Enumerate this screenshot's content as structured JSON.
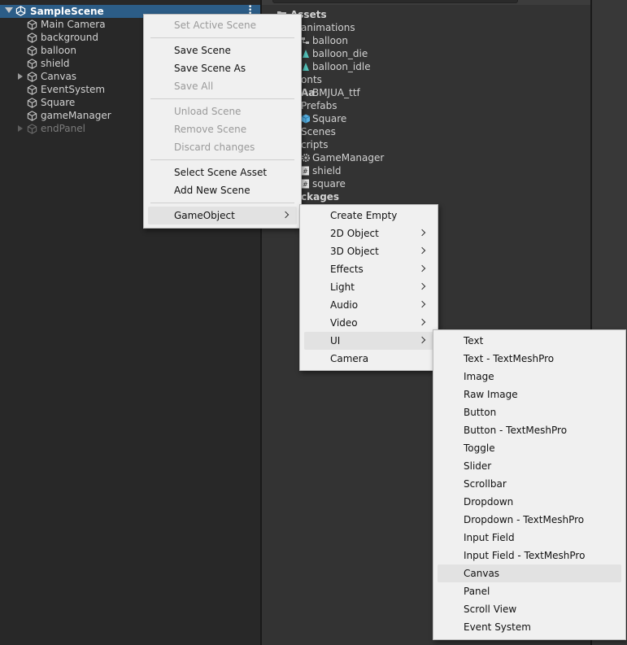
{
  "hierarchy": {
    "scene_name": "SampleScene",
    "items": [
      {
        "label": "Main Camera",
        "dim": false,
        "expandable": false
      },
      {
        "label": "background",
        "dim": false,
        "expandable": false
      },
      {
        "label": "balloon",
        "dim": false,
        "expandable": false
      },
      {
        "label": "shield",
        "dim": false,
        "expandable": false
      },
      {
        "label": "Canvas",
        "dim": false,
        "expandable": true
      },
      {
        "label": "EventSystem",
        "dim": false,
        "expandable": false
      },
      {
        "label": "Square",
        "dim": false,
        "expandable": false
      },
      {
        "label": "gameManager",
        "dim": false,
        "expandable": false
      },
      {
        "label": "endPanel",
        "dim": true,
        "expandable": true
      }
    ]
  },
  "project": {
    "items": [
      {
        "label": "Assets",
        "bold": true,
        "icon": "folder-icon"
      },
      {
        "label": "animations",
        "bold": false,
        "icon": ""
      },
      {
        "label": "balloon",
        "bold": false,
        "icon": "animator-icon"
      },
      {
        "label": "balloon_die",
        "bold": false,
        "icon": "animation-clip-icon"
      },
      {
        "label": "balloon_idle",
        "bold": false,
        "icon": "animation-clip-icon"
      },
      {
        "label": "onts",
        "bold": false,
        "icon": ""
      },
      {
        "label": "BMJUA_ttf",
        "bold": false,
        "icon": "font-icon"
      },
      {
        "label": "Prefabs",
        "bold": false,
        "icon": ""
      },
      {
        "label": "Square",
        "bold": false,
        "icon": "prefab-icon"
      },
      {
        "label": "Scenes",
        "bold": false,
        "icon": ""
      },
      {
        "label": "cripts",
        "bold": false,
        "icon": ""
      },
      {
        "label": "GameManager",
        "bold": false,
        "icon": "gear-icon"
      },
      {
        "label": "shield",
        "bold": false,
        "icon": "script-icon"
      },
      {
        "label": "square",
        "bold": false,
        "icon": "script-icon"
      },
      {
        "label": "ckages",
        "bold": true,
        "icon": ""
      }
    ],
    "font_icon_text": "Aa"
  },
  "context_menu": {
    "items": [
      {
        "label": "Set Active Scene",
        "disabled": true
      },
      {
        "label": "Save Scene",
        "disabled": false
      },
      {
        "label": "Save Scene As",
        "disabled": false
      },
      {
        "label": "Save All",
        "disabled": true
      },
      {
        "label": "Unload Scene",
        "disabled": true
      },
      {
        "label": "Remove Scene",
        "disabled": true
      },
      {
        "label": "Discard changes",
        "disabled": true
      },
      {
        "label": "Select Scene Asset",
        "disabled": false
      },
      {
        "label": "Add New Scene",
        "disabled": false
      },
      {
        "label": "GameObject",
        "disabled": false,
        "submenu": true,
        "highlighted": true
      }
    ]
  },
  "gameobject_menu": {
    "items": [
      {
        "label": "Create Empty",
        "submenu": false
      },
      {
        "label": "2D Object",
        "submenu": true
      },
      {
        "label": "3D Object",
        "submenu": true
      },
      {
        "label": "Effects",
        "submenu": true
      },
      {
        "label": "Light",
        "submenu": true
      },
      {
        "label": "Audio",
        "submenu": true
      },
      {
        "label": "Video",
        "submenu": true
      },
      {
        "label": "UI",
        "submenu": true,
        "highlighted": true
      },
      {
        "label": "Camera",
        "submenu": false
      }
    ]
  },
  "ui_menu": {
    "items": [
      {
        "label": "Text"
      },
      {
        "label": "Text - TextMeshPro"
      },
      {
        "label": "Image"
      },
      {
        "label": "Raw Image"
      },
      {
        "label": "Button"
      },
      {
        "label": "Button - TextMeshPro"
      },
      {
        "label": "Toggle"
      },
      {
        "label": "Slider"
      },
      {
        "label": "Scrollbar"
      },
      {
        "label": "Dropdown"
      },
      {
        "label": "Dropdown - TextMeshPro"
      },
      {
        "label": "Input Field"
      },
      {
        "label": "Input Field - TextMeshPro"
      },
      {
        "label": "Canvas",
        "highlighted": true
      },
      {
        "label": "Panel"
      },
      {
        "label": "Scroll View"
      },
      {
        "label": "Event System"
      }
    ]
  },
  "colors": {
    "selection": "#2c5d87",
    "menu_bg": "#f0f0f0",
    "menu_highlight": "#e2e2e2",
    "prefab_blue": "#5ab4e6",
    "anim_teal": "#56c8c0"
  }
}
